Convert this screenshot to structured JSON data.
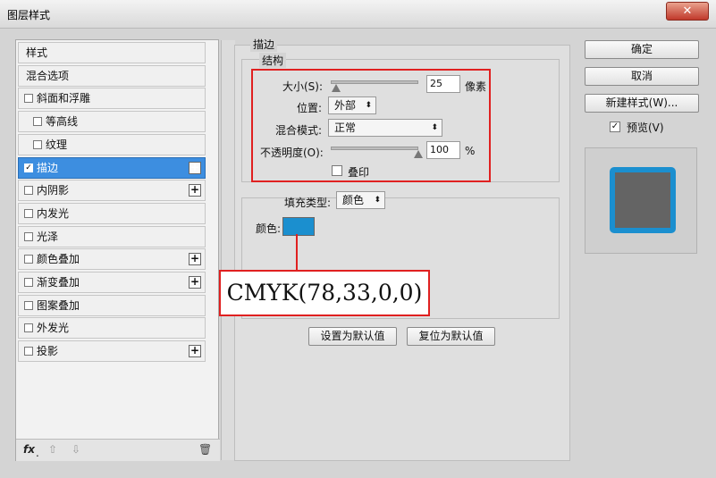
{
  "window": {
    "title": "图层样式",
    "close_label": "✕"
  },
  "styles_panel": {
    "items": [
      {
        "label": "样式",
        "checkbox": false,
        "plus": false,
        "indent": 0
      },
      {
        "label": "混合选项",
        "checkbox": false,
        "plus": false,
        "indent": 0
      },
      {
        "label": "斜面和浮雕",
        "checkbox": true,
        "checked": false,
        "plus": false,
        "indent": 0
      },
      {
        "label": "等高线",
        "checkbox": true,
        "checked": false,
        "plus": false,
        "indent": 1
      },
      {
        "label": "纹理",
        "checkbox": true,
        "checked": false,
        "plus": false,
        "indent": 1
      },
      {
        "label": "描边",
        "checkbox": true,
        "checked": true,
        "plus": true,
        "indent": 0,
        "selected": true
      },
      {
        "label": "内阴影",
        "checkbox": true,
        "checked": false,
        "plus": true,
        "indent": 0
      },
      {
        "label": "内发光",
        "checkbox": true,
        "checked": false,
        "plus": false,
        "indent": 0
      },
      {
        "label": "光泽",
        "checkbox": true,
        "checked": false,
        "plus": false,
        "indent": 0
      },
      {
        "label": "颜色叠加",
        "checkbox": true,
        "checked": false,
        "plus": true,
        "indent": 0
      },
      {
        "label": "渐变叠加",
        "checkbox": true,
        "checked": false,
        "plus": true,
        "indent": 0
      },
      {
        "label": "图案叠加",
        "checkbox": true,
        "checked": false,
        "plus": false,
        "indent": 0
      },
      {
        "label": "外发光",
        "checkbox": true,
        "checked": false,
        "plus": false,
        "indent": 0
      },
      {
        "label": "投影",
        "checkbox": true,
        "checked": false,
        "plus": true,
        "indent": 0
      }
    ],
    "fx_label": "fx",
    "fx_sub": ".",
    "up_arrow": "⇧",
    "down_arrow": "⇩",
    "trash_icon": "🗑"
  },
  "stroke": {
    "section_title": "描边",
    "structure_title": "结构",
    "size_label": "大小(S):",
    "size_value": "25",
    "size_unit": "像素",
    "size_slider_pct": 6,
    "position_label": "位置:",
    "position_value": "外部",
    "blend_label": "混合模式:",
    "blend_value": "正常",
    "opacity_label": "不透明度(O):",
    "opacity_value": "100",
    "opacity_unit": "%",
    "opacity_slider_pct": 100,
    "overprint_label": "叠印",
    "fill_type_label": "填充类型:",
    "fill_type_value": "颜色",
    "color_label": "颜色:",
    "color_hex": "#1b8fcf",
    "annotation": "CMYK(78,33,0,0)",
    "set_default": "设置为默认值",
    "reset_default": "复位为默认值"
  },
  "actions": {
    "ok": "确定",
    "cancel": "取消",
    "new_style": "新建样式(W)...",
    "preview_label": "预览(V)",
    "preview_checked": true
  }
}
